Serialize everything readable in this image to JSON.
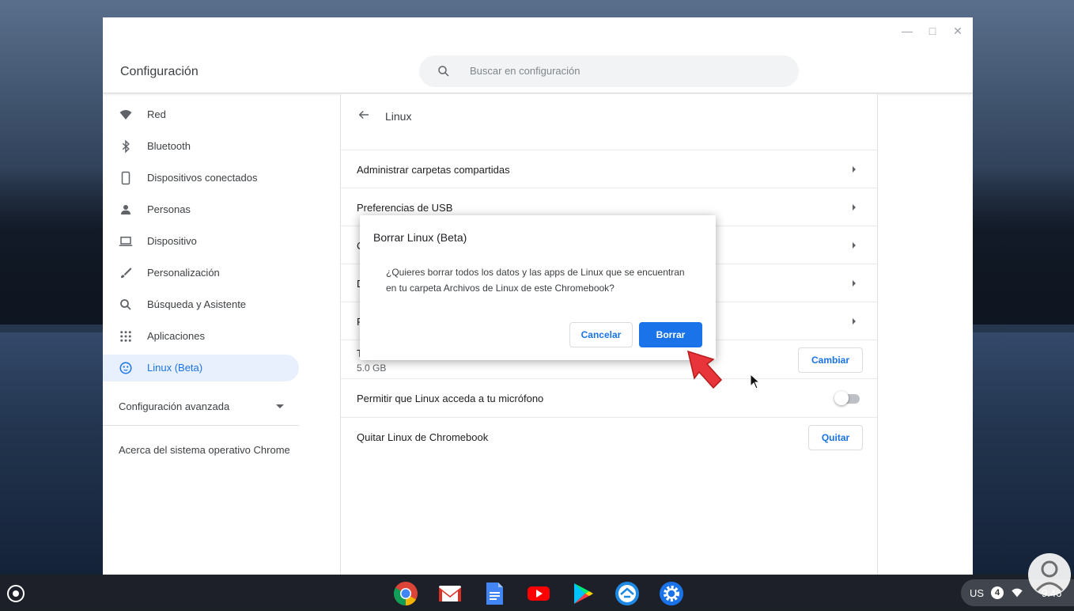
{
  "window": {
    "title": "Configuración",
    "search_placeholder": "Buscar en configuración"
  },
  "sidebar": {
    "items": [
      {
        "label": "Red",
        "icon": "wifi-icon"
      },
      {
        "label": "Bluetooth",
        "icon": "bluetooth-icon"
      },
      {
        "label": "Dispositivos conectados",
        "icon": "phone-icon"
      },
      {
        "label": "Personas",
        "icon": "person-icon"
      },
      {
        "label": "Dispositivo",
        "icon": "laptop-icon"
      },
      {
        "label": "Personalización",
        "icon": "brush-icon"
      },
      {
        "label": "Búsqueda y Asistente",
        "icon": "search-icon"
      },
      {
        "label": "Aplicaciones",
        "icon": "apps-grid-icon"
      },
      {
        "label": "Linux (Beta)",
        "icon": "penguin-icon",
        "active": true
      }
    ],
    "advanced_label": "Configuración avanzada",
    "about_label": "Acerca del sistema operativo Chrome"
  },
  "main": {
    "page_title": "Linux",
    "rows": [
      {
        "label": "Administrar carpetas compartidas"
      },
      {
        "label": "Preferencias de USB"
      },
      {
        "label": "C"
      },
      {
        "label": "D"
      },
      {
        "label": "R"
      }
    ],
    "disk": {
      "label": "T",
      "size": "5.0 GB",
      "button": "Cambiar"
    },
    "mic": {
      "label": "Permitir que Linux acceda a tu micrófono",
      "enabled": false
    },
    "remove": {
      "label": "Quitar Linux de Chromebook",
      "button": "Quitar"
    }
  },
  "dialog": {
    "title": "Borrar Linux (Beta)",
    "body_line1": "¿Quieres borrar todos los datos y las apps de Linux que se encuentran",
    "body_line2": "en tu carpeta Archivos de Linux de este Chromebook?",
    "cancel": "Cancelar",
    "confirm": "Borrar"
  },
  "shelf": {
    "apps": [
      "chrome-icon",
      "gmail-icon",
      "docs-icon",
      "youtube-icon",
      "play-store-icon",
      "remote-desktop-icon",
      "settings-icon"
    ],
    "keyboard": "US",
    "notifications": "4",
    "time": "9:46"
  },
  "colors": {
    "accent": "#1a73e8",
    "annotation": "#e8343b"
  }
}
